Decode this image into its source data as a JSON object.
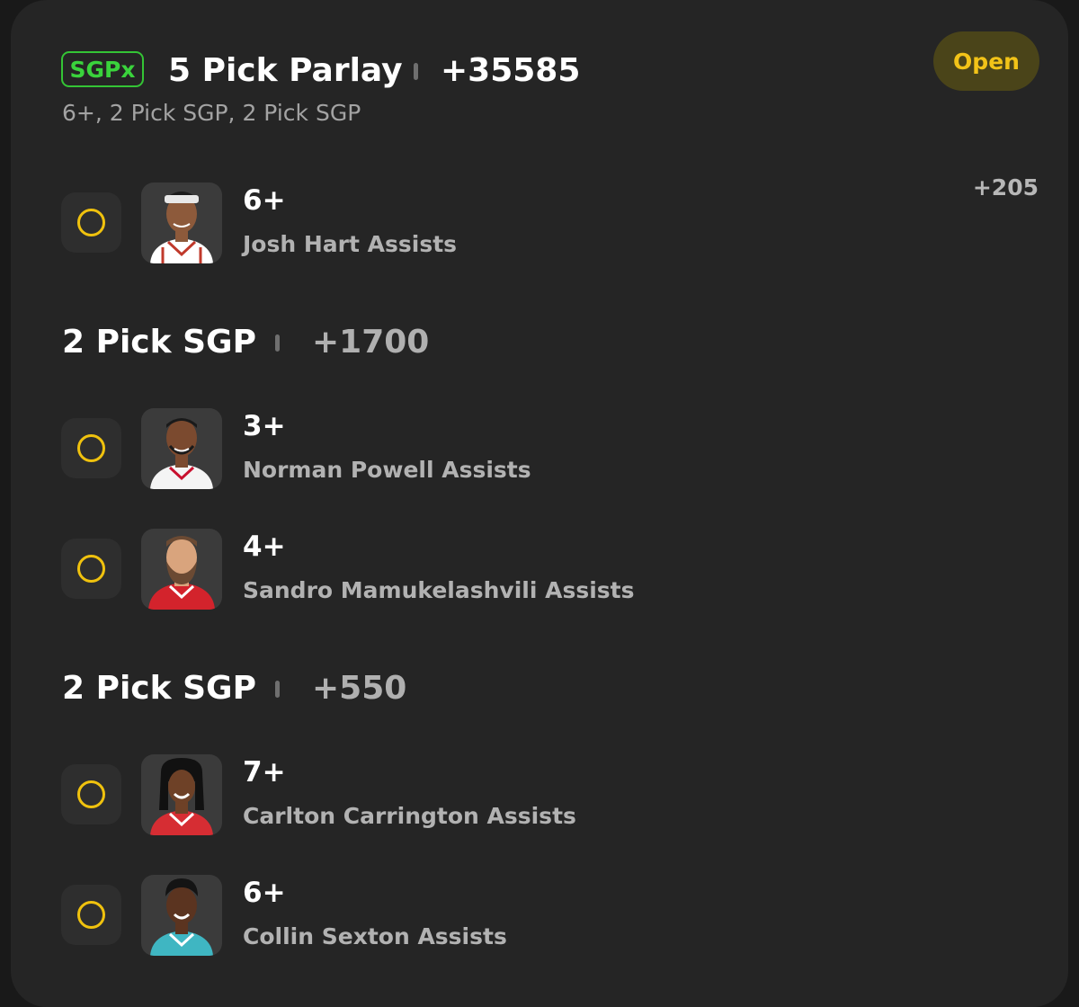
{
  "header": {
    "badge": "SGPx",
    "title": "5 Pick Parlay",
    "odds": "+35585",
    "subtitle": "6+, 2 Pick SGP, 2 Pick SGP",
    "status": "Open"
  },
  "single_leg": {
    "line": "6+",
    "market": "Josh Hart Assists",
    "odds": "+205",
    "avatar": "player-photo"
  },
  "groups": [
    {
      "title": "2 Pick SGP",
      "odds": "+1700",
      "legs": [
        {
          "line": "3+",
          "market": "Norman Powell Assists",
          "avatar": "player-photo"
        },
        {
          "line": "4+",
          "market": "Sandro Mamukelashvili Assists",
          "avatar": "player-photo"
        }
      ]
    },
    {
      "title": "2 Pick SGP",
      "odds": "+550",
      "legs": [
        {
          "line": "7+",
          "market": "Carlton Carrington Assists",
          "avatar": "player-photo"
        },
        {
          "line": "6+",
          "market": "Collin Sexton Assists",
          "avatar": "player-photo"
        }
      ]
    }
  ],
  "colors": {
    "background": "#191919",
    "card": "#252525",
    "badge_green": "#3ad33c",
    "accent_yellow": "#f0c20e",
    "open_pill_bg": "#4a4419"
  },
  "jerseys": {
    "josh_hart": {
      "jersey": "#ffffff",
      "trim": "#c0392b",
      "skin": "#8d5a3b",
      "hair": "#1c1c1c",
      "headband": "#e8e8e8"
    },
    "norman_powell": {
      "jersey": "#f4f4f4",
      "trim": "#c8102e",
      "skin": "#7b4a2f",
      "hair": "#1a1a1a"
    },
    "sandro": {
      "jersey": "#d3232c",
      "trim": "#ffffff",
      "skin": "#d9a47d",
      "hair": "#6b4a33"
    },
    "carlton": {
      "jersey": "#d62d33",
      "trim": "#ffffff",
      "skin": "#6e4127",
      "hair": "#111111"
    },
    "collin": {
      "jersey": "#3fb6c2",
      "trim": "#ffffff",
      "skin": "#5b3420",
      "hair": "#141414"
    }
  }
}
